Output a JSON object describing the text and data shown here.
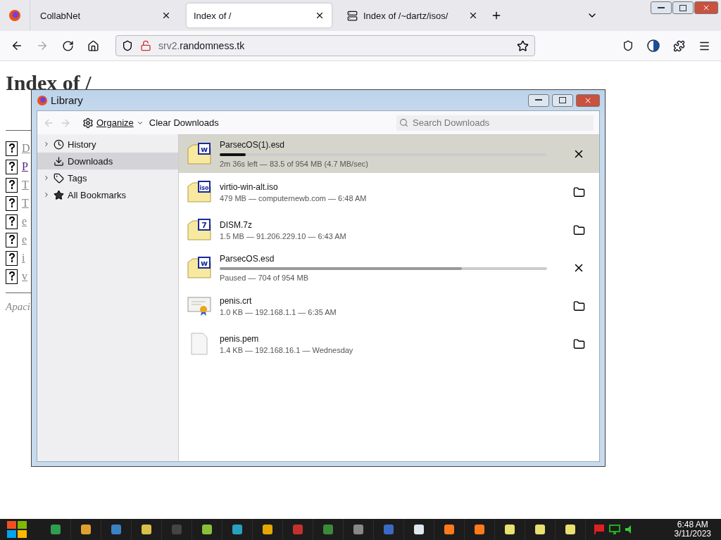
{
  "browser": {
    "tabs": [
      {
        "label": "CollabNet",
        "selected": false,
        "kind": "plain"
      },
      {
        "label": "Index of /",
        "selected": true,
        "kind": "plain"
      },
      {
        "label": "Index of /~dartz/isos/",
        "selected": false,
        "kind": "server"
      }
    ],
    "url_host": "srv2.",
    "url_domain": "randomness.tk"
  },
  "page": {
    "heading": "Index of /",
    "entries": [
      {
        "text": "D",
        "visited": false
      },
      {
        "text": "P",
        "visited": true
      },
      {
        "text": "T",
        "visited": false
      },
      {
        "text": "T",
        "visited": false
      },
      {
        "text": "e",
        "visited": false
      },
      {
        "text": "e",
        "visited": false
      },
      {
        "text": "i",
        "visited": false
      },
      {
        "text": "v",
        "visited": false
      }
    ],
    "footer": "Apaci"
  },
  "library": {
    "title": "Library",
    "organize": "Organize",
    "clear": "Clear Downloads",
    "search_placeholder": "Search Downloads",
    "sidebar": [
      {
        "label": "History",
        "kind": "history",
        "expanded": false,
        "selected": false
      },
      {
        "label": "Downloads",
        "kind": "downloads",
        "selected": true
      },
      {
        "label": "Tags",
        "kind": "tags",
        "expanded": false,
        "selected": false
      },
      {
        "label": "All Bookmarks",
        "kind": "bookmarks",
        "expanded": false,
        "selected": false
      }
    ],
    "downloads": [
      {
        "name": "ParsecOS(1).esd",
        "status": "2m 36s left — 83.5 of 954 MB (4.7 MB/sec)",
        "paused": false,
        "level": 0.08,
        "selected": true,
        "kind": "archive",
        "badge": "w"
      },
      {
        "name": "virtio-win-alt.iso",
        "status": "479 MB — computernewb.com — 6:48 AM",
        "selected": false,
        "kind": "archive",
        "badge": "iso"
      },
      {
        "name": "DISM.7z",
        "status": "1.5 MB — 91.206.229.10 — 6:43 AM",
        "selected": false,
        "kind": "archive",
        "badge": "7"
      },
      {
        "name": "ParsecOS.esd",
        "status": "Paused — 704 of 954 MB",
        "paused": true,
        "level": 0.74,
        "selected": false,
        "kind": "archive",
        "badge": "w"
      },
      {
        "name": "penis.crt",
        "status": "1.0 KB — 192.168.1.1 — 6:35 AM",
        "selected": false,
        "kind": "certificate"
      },
      {
        "name": "penis.pem",
        "status": "1.4 KB — 192.168.16.1 — Wednesday",
        "selected": false,
        "kind": "blank"
      }
    ]
  },
  "taskbar": {
    "time": "6:48 AM",
    "date": "3/11/2023"
  }
}
